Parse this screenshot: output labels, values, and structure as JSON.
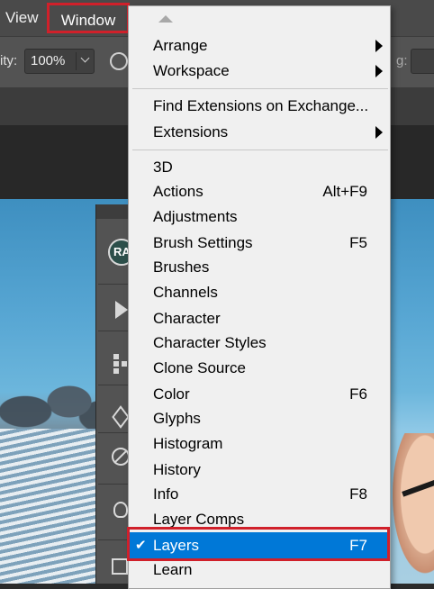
{
  "menubar": {
    "view_label": "View",
    "window_label": "Window"
  },
  "options_bar": {
    "opacity_label": "ity:",
    "opacity_value": "100%",
    "right_label": "g:"
  },
  "tools_panel": {
    "avatar_text": "RA"
  },
  "window_menu": {
    "group1": [
      {
        "label": "Arrange",
        "submenu": true
      },
      {
        "label": "Workspace",
        "submenu": true
      }
    ],
    "group2": [
      {
        "label": "Find Extensions on Exchange...",
        "submenu": false
      },
      {
        "label": "Extensions",
        "submenu": true
      }
    ],
    "group3": [
      {
        "label": "3D",
        "shortcut": ""
      },
      {
        "label": "Actions",
        "shortcut": "Alt+F9"
      },
      {
        "label": "Adjustments",
        "shortcut": ""
      },
      {
        "label": "Brush Settings",
        "shortcut": "F5"
      },
      {
        "label": "Brushes",
        "shortcut": ""
      },
      {
        "label": "Channels",
        "shortcut": ""
      },
      {
        "label": "Character",
        "shortcut": ""
      },
      {
        "label": "Character Styles",
        "shortcut": ""
      },
      {
        "label": "Clone Source",
        "shortcut": ""
      },
      {
        "label": "Color",
        "shortcut": "F6"
      },
      {
        "label": "Glyphs",
        "shortcut": ""
      },
      {
        "label": "Histogram",
        "shortcut": ""
      },
      {
        "label": "History",
        "shortcut": ""
      },
      {
        "label": "Info",
        "shortcut": "F8"
      },
      {
        "label": "Layer Comps",
        "shortcut": ""
      },
      {
        "label": "Layers",
        "shortcut": "F7",
        "checked": true,
        "highlighted": true
      },
      {
        "label": "Learn",
        "shortcut": ""
      }
    ]
  },
  "colors": {
    "highlight": "#0078d7",
    "annotation_outline": "#d0202a"
  }
}
